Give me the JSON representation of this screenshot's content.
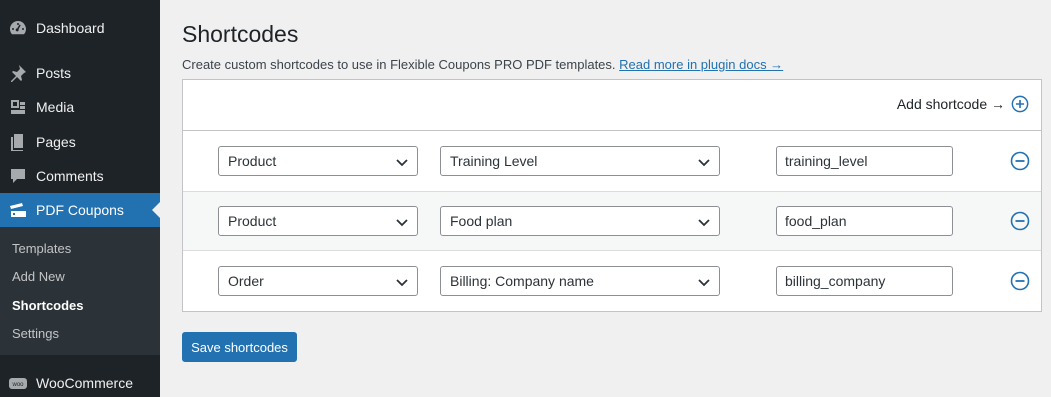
{
  "sidebar": {
    "menu": [
      {
        "label": "Dashboard",
        "icon": "dashboard-icon"
      },
      {
        "label": "Posts",
        "icon": "pushpin-icon"
      },
      {
        "label": "Media",
        "icon": "media-icon"
      },
      {
        "label": "Pages",
        "icon": "pages-icon"
      },
      {
        "label": "Comments",
        "icon": "comment-icon"
      },
      {
        "label": "PDF Coupons",
        "icon": "coupon-icon"
      },
      {
        "label": "WooCommerce",
        "icon": "woocommerce-icon"
      }
    ],
    "submenu": [
      {
        "label": "Templates"
      },
      {
        "label": "Add New"
      },
      {
        "label": "Shortcodes"
      },
      {
        "label": "Settings"
      }
    ],
    "active_color": "#2271b1"
  },
  "page": {
    "title": "Shortcodes",
    "description": "Create custom shortcodes to use in Flexible Coupons PRO PDF templates.",
    "docs_link": "Read more in plugin docs →"
  },
  "panel": {
    "add_label": "Add shortcode →",
    "rows": [
      {
        "type": "Product",
        "field": "Training Level",
        "shortcode": "training_level"
      },
      {
        "type": "Product",
        "field": "Food plan",
        "shortcode": "food_plan"
      },
      {
        "type": "Order",
        "field": "Billing: Company name",
        "shortcode": "billing_company"
      }
    ]
  },
  "actions": {
    "save_label": "Save shortcodes"
  }
}
